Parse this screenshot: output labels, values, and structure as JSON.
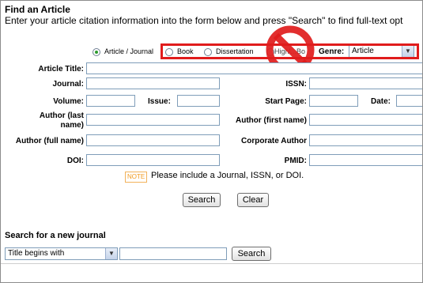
{
  "header": {
    "title": "Find an Article",
    "instructions": "Enter your article citation information into the form below and press \"Search\" to find full-text opt"
  },
  "format_options": {
    "article_journal": "Article / Journal",
    "book": "Book",
    "dissertation": "Dissertation",
    "highlighted": "Highl...Bo",
    "genre_label": "Genre:",
    "genre_value": "Article"
  },
  "fields": {
    "article_title": "Article Title:",
    "journal": "Journal:",
    "issn": "ISSN:",
    "volume": "Volume:",
    "issue": "Issue:",
    "start_page": "Start Page:",
    "date": "Date:",
    "author_last_line1": "Author (last",
    "author_last_line2": "name)",
    "author_first": "Author (first name)",
    "author_full": "Author (full name)",
    "corporate_author": "Corporate Author",
    "doi": "DOI:",
    "pmid": "PMID:"
  },
  "note": {
    "badge": "NOTE",
    "text": "Please include a Journal, ISSN, or DOI."
  },
  "buttons": {
    "search": "Search",
    "clear": "Clear"
  },
  "journal_search": {
    "title": "Search for a new journal",
    "select_value": "Title begins with",
    "input_value": "",
    "button": "Search"
  },
  "colors": {
    "annotation_red": "#e01c1c",
    "field_border": "#7f9db9",
    "radio_selected": "#2c9b2c",
    "note_orange": "#f29a1e"
  }
}
